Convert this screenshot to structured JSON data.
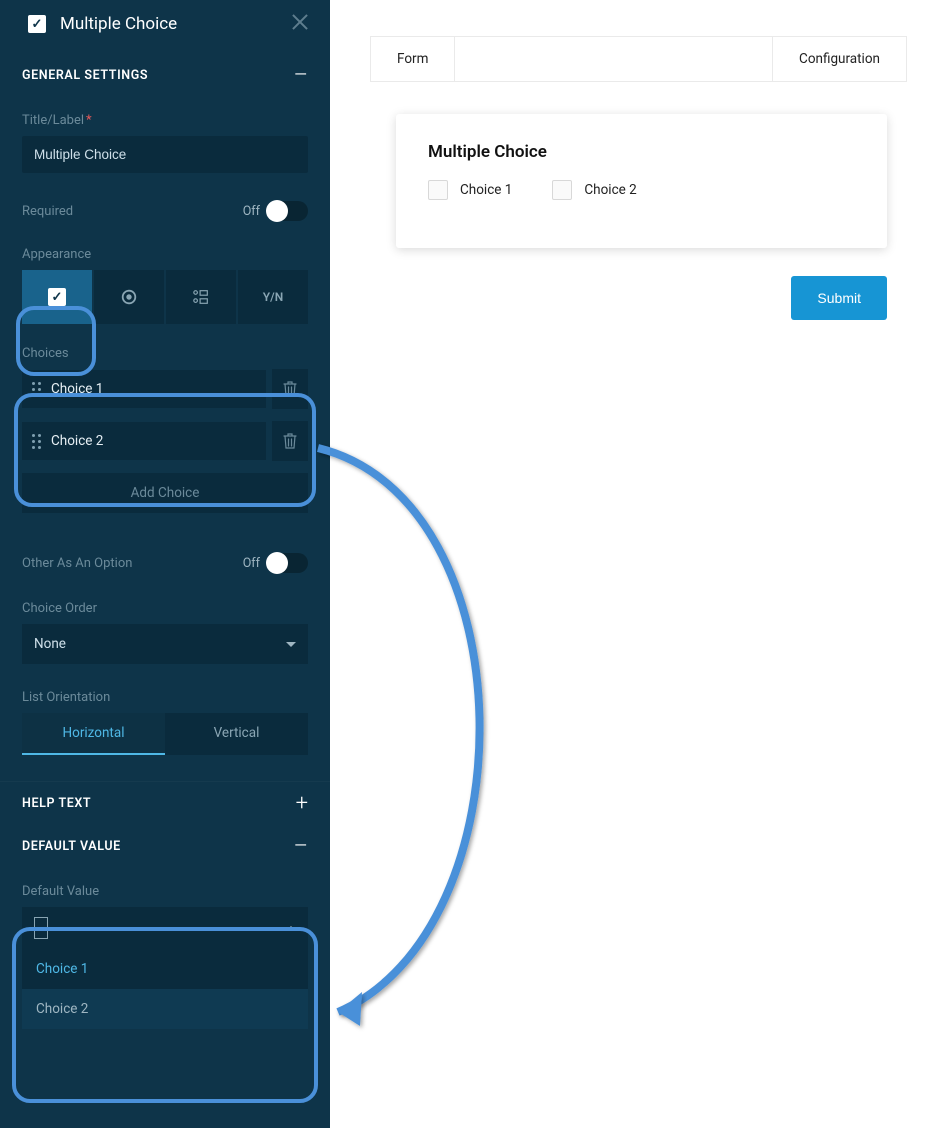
{
  "sidebar": {
    "title": "Multiple Choice",
    "sections": {
      "general": {
        "header": "GENERAL SETTINGS",
        "collapse_icon": "–",
        "title_label": "Title/Label",
        "title_value": "Multiple Choice",
        "required_label": "Required",
        "required_state": "Off",
        "appearance_label": "Appearance",
        "appearance_options": [
          "checkbox",
          "radio",
          "image-grid",
          "Y/N"
        ],
        "choices_label": "Choices",
        "choices": [
          "Choice 1",
          "Choice 2"
        ],
        "add_choice_label": "Add Choice",
        "other_label": "Other As An Option",
        "other_state": "Off",
        "order_label": "Choice Order",
        "order_value": "None",
        "orientation_label": "List Orientation",
        "orientation_options": [
          "Horizontal",
          "Vertical"
        ],
        "orientation_selected": "Horizontal"
      },
      "help": {
        "header": "HELP TEXT",
        "collapse_icon": "+"
      },
      "default_value": {
        "header": "DEFAULT VALUE",
        "collapse_icon": "–",
        "label": "Default Value",
        "options": [
          "Choice 1",
          "Choice 2"
        ]
      }
    }
  },
  "main": {
    "tabs": {
      "form": "Form",
      "config": "Configuration"
    },
    "preview": {
      "title": "Multiple Choice",
      "options": [
        "Choice 1",
        "Choice 2"
      ]
    },
    "submit_label": "Submit"
  },
  "colors": {
    "sidebar_bg": "#0e3449",
    "input_bg": "#0a2b3d",
    "accent": "#4a90d9",
    "active_appearance": "#19638c",
    "submit": "#1795d4"
  }
}
